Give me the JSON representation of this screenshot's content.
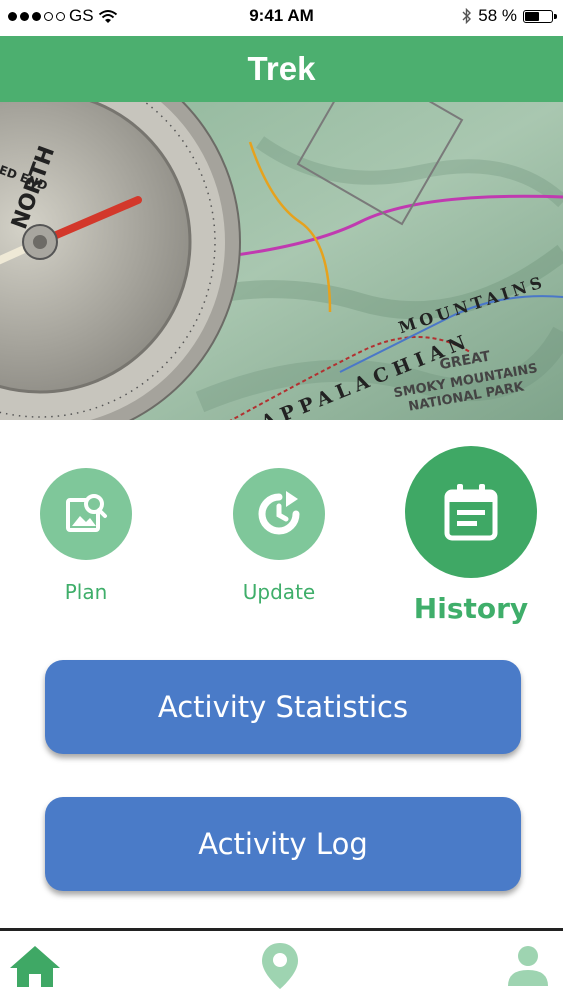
{
  "status_bar": {
    "carrier": "GS",
    "time": "9:41 AM",
    "battery_percent": "58 %",
    "battery_level": 0.58,
    "signal_dots_filled": 3,
    "signal_dots_total": 5
  },
  "header": {
    "title": "Trek"
  },
  "hero": {
    "map_labels": [
      "APPALACHIAN",
      "MOUNTAINS",
      "GREAT",
      "SMOKY MOUNTAINS",
      "NATIONAL PARK",
      "NORTH",
      "RED END"
    ]
  },
  "actions": [
    {
      "label": "Plan",
      "icon": "image-search-icon",
      "selected": false
    },
    {
      "label": "Update",
      "icon": "history-clock-icon",
      "selected": false
    },
    {
      "label": "History",
      "icon": "calendar-icon",
      "selected": true
    }
  ],
  "buttons": {
    "activity_statistics": "Activity Statistics",
    "activity_log": "Activity Log"
  },
  "tabbar": {
    "items": [
      {
        "icon": "home-icon",
        "active": true
      },
      {
        "icon": "location-pin-icon",
        "active": false
      },
      {
        "icon": "profile-icon",
        "active": false
      }
    ]
  },
  "colors": {
    "brand_green": "#4caf6f",
    "light_green": "#7fc79a",
    "button_blue": "#4a7bc8"
  }
}
